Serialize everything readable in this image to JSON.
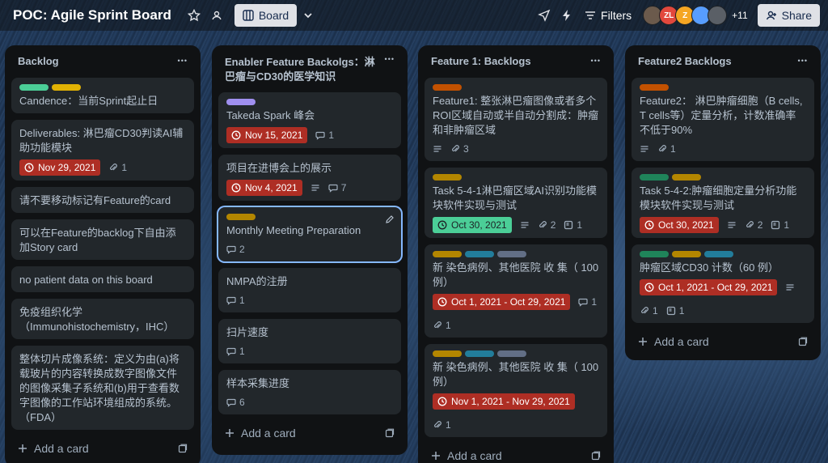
{
  "header": {
    "board_title": "POC: Agile Sprint Board",
    "view_label": "Board",
    "filters_label": "Filters",
    "more_members": "+11",
    "share_label": "Share",
    "members": [
      {
        "initials": "",
        "color": "#6b5a4c"
      },
      {
        "initials": "ZL",
        "color": "#e2483d"
      },
      {
        "initials": "Z",
        "color": "#f5a623"
      },
      {
        "initials": "",
        "color": "#579dff"
      },
      {
        "initials": "",
        "color": "#5a5f66"
      }
    ]
  },
  "lists": [
    {
      "title": "Backlog",
      "add_label": "Add a card",
      "cards": [
        {
          "labels": [
            "#4bce97",
            "#e2b203"
          ],
          "title": "Candence：当前Sprint起止日"
        },
        {
          "title": "Deliverables: 淋巴瘤CD30判读AI辅助功能模块",
          "due": "Nov 29, 2021",
          "attachments": "1"
        },
        {
          "title": "请不要移动标记有Feature的card"
        },
        {
          "title": "可以在Feature的backlog下自由添加Story card"
        },
        {
          "title": "no patient data on this board"
        },
        {
          "title": "免疫组织化学（Immunohistochemistry，IHC）"
        },
        {
          "title": "整体切片成像系统：定义为由(a)将载玻片的内容转换成数字图像文件的图像采集子系统和(b)用于查看数字图像的工作站环境组成的系统。（FDA）"
        }
      ]
    },
    {
      "title": "Enabler Feature Backolgs：淋巴瘤与CD30的医学知识",
      "add_label": "Add a card",
      "cards": [
        {
          "labels": [
            "#9f8fef"
          ],
          "title": "Takeda Spark 峰会",
          "due": "Nov 15, 2021",
          "comments": "1"
        },
        {
          "title": "项目在进博会上的展示",
          "due": "Nov 4, 2021",
          "comments": "7"
        },
        {
          "labels": [
            "#b38600"
          ],
          "title": "Monthly Meeting Preparation",
          "comments": "2"
        },
        {
          "title": "NMPA的注册",
          "comments": "1"
        },
        {
          "title": "扫片速度",
          "comments": "1"
        },
        {
          "title": "样本采集进度",
          "comments": "6"
        }
      ]
    },
    {
      "title": "Feature 1: Backlogs",
      "add_label": "Add a card",
      "cards": [
        {
          "labels": [
            "#c25100"
          ],
          "title": "Feature1: 整张淋巴瘤图像或者多个ROI区域自动或半自动分割成：肿瘤和非肿瘤区域",
          "attachments": "3"
        },
        {
          "labels": [
            "#b38600"
          ],
          "title": "Task 5-4-1淋巴瘤区域AI识别功能模块软件实现与测试",
          "due": "Oct 30, 2021",
          "attachments": "2",
          "checklist": "1"
        },
        {
          "labels": [
            "#b38600",
            "#227d9b",
            "#626f86"
          ],
          "title": "新 染色病例、其他医院 收 集（ 100 例）",
          "due": "Oct 1, 2021 - Oct 29, 2021",
          "comments": "1",
          "attachments": "1"
        },
        {
          "labels": [
            "#b38600",
            "#227d9b",
            "#626f86"
          ],
          "title": "新 染色病例、其他医院 收 集（ 100 例）",
          "due": "Nov 1, 2021 - Nov 29, 2021",
          "attachments": "1"
        }
      ]
    },
    {
      "title": "Feature2 Backlogs",
      "add_label": "Add a card",
      "cards": [
        {
          "labels": [
            "#c25100"
          ],
          "title": "Feature2： 淋巴肿瘤细胞（B cells, T cells等）定量分析，计数准确率不低于90%",
          "attachments": "1"
        },
        {
          "labels": [
            "#1f845a",
            "#b38600"
          ],
          "title": "Task 5-4-2:肿瘤细胞定量分析功能模块软件实现与测试",
          "due": "Oct 30, 2021",
          "attachments": "2",
          "checklist": "1"
        },
        {
          "labels": [
            "#1f845a",
            "#b38600",
            "#227d9b"
          ],
          "title": "肿瘤区域CD30 计数（60 例）",
          "due": "Oct 1, 2021 - Oct 29, 2021",
          "attachments": "1",
          "checklist": "1"
        }
      ]
    }
  ]
}
